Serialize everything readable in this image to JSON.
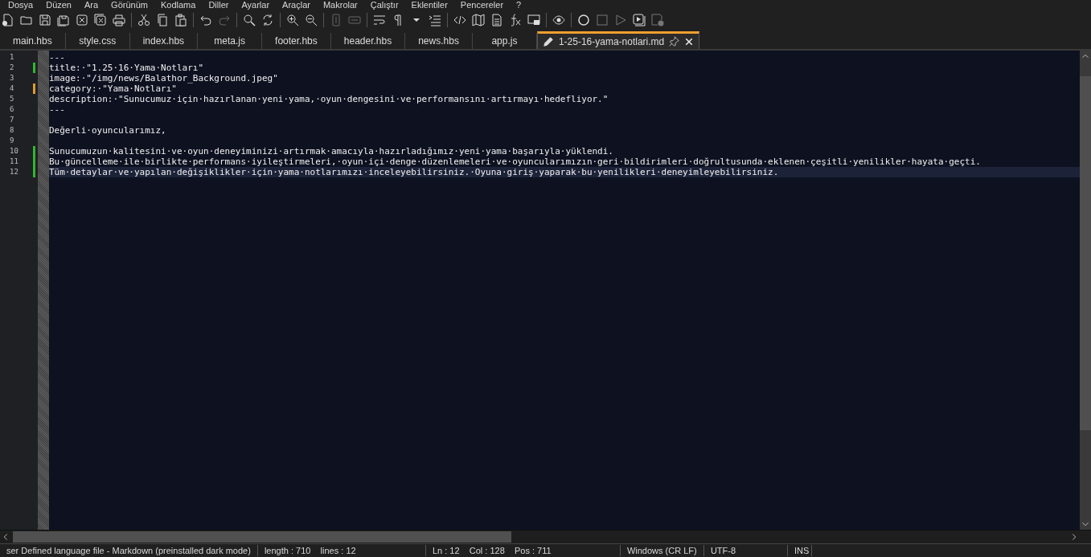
{
  "menu": [
    "Dosya",
    "Düzen",
    "Ara",
    "Görünüm",
    "Kodlama",
    "Diller",
    "Ayarlar",
    "Araçlar",
    "Makrolar",
    "Çalıştır",
    "Eklentiler",
    "Pencereler",
    "?"
  ],
  "tabs": [
    {
      "label": "main.hbs",
      "selected": false
    },
    {
      "label": "style.css",
      "selected": false
    },
    {
      "label": "index.hbs",
      "selected": false
    },
    {
      "label": "meta.js",
      "selected": false
    },
    {
      "label": "footer.hbs",
      "selected": false
    },
    {
      "label": "header.hbs",
      "selected": false
    },
    {
      "label": "news.hbs",
      "selected": false
    },
    {
      "label": "app.js",
      "selected": false
    },
    {
      "label": "1-25-16-yama-notlari.md",
      "selected": true
    }
  ],
  "editor": {
    "lines": [
      {
        "number": "1",
        "text": "---",
        "current": false
      },
      {
        "number": "2",
        "text": "title:·\"1.25·16·Yama·Notları\"",
        "color": "#2fb82f",
        "current": false
      },
      {
        "number": "3",
        "text": "image:·\"/img/news/Balathor_Background.jpeg\"",
        "current": false
      },
      {
        "number": "4",
        "text": "category:·\"Yama·Notları\"",
        "color": "#e09a2a",
        "current": false
      },
      {
        "number": "5",
        "text": "description:·\"Sunucumuz·için·hazırlanan·yeni·yama,·oyun·dengesini·ve·performansını·artırmayı·hedefliyor.\"",
        "current": false
      },
      {
        "number": "6",
        "text": "---",
        "current": false
      },
      {
        "number": "7",
        "current": false
      },
      {
        "number": "8",
        "text": "Değerli·oyuncularımız,",
        "current": false
      },
      {
        "number": "9",
        "current": false
      },
      {
        "number": "10",
        "text": "Sunucumuzun·kalitesini·ve·oyun·deneyiminizi·artırmak·amacıyla·hazırladığımız·yeni·yama·başarıyla·yüklendi.",
        "color": "#2fb82f",
        "current": false
      },
      {
        "number": "11",
        "text": "Bu·güncelleme·ile·birlikte·performans·iyileştirmeleri,·oyun·içi·denge·düzenlemeleri·ve·oyuncularımızın·geri·bildirimleri·doğrultusunda·eklenen·çeşitli·yenilikler·hayata·geçti.",
        "color": "#2fb82f",
        "current": false
      },
      {
        "number": "12",
        "text": "Tüm·detaylar·ve·yapılan·değişiklikler·için·yama·notlarımızı·inceleyebilirsiniz.·Oyuna·giriş·yaparak·bu·yenilikleri·deneyimleyebilirsiniz.",
        "color": "#2fb82f",
        "current": true
      }
    ]
  },
  "status_bar": [
    "ser Defined language file - Markdown (preinstalled dark mode)",
    "length : 710    lines : 12",
    "Ln : 12    Col : 128    Pos : 711",
    "Windows (CR LF)",
    "UTF-8",
    "INS"
  ]
}
